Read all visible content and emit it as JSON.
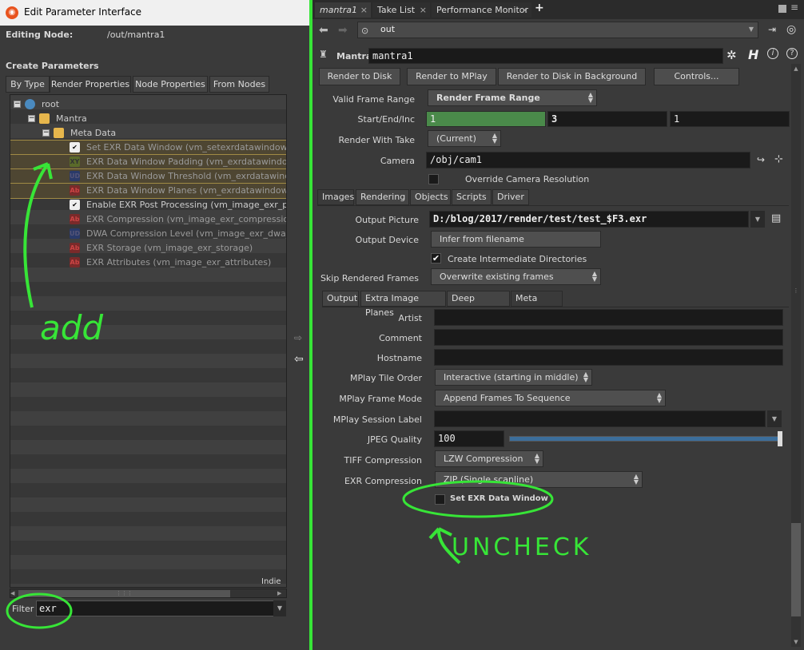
{
  "left_panel": {
    "title": "Edit Parameter Interface",
    "editing_node_label": "Editing Node:",
    "editing_node_value": "/out/mantra1",
    "create_params_label": "Create Parameters",
    "tabs": [
      "By Type",
      "Render Properties",
      "Node Properties",
      "From Nodes"
    ],
    "tree": [
      {
        "label": "root",
        "indent": 0
      },
      {
        "label": "Mantra",
        "indent": 1
      },
      {
        "label": "Meta Data",
        "indent": 2
      },
      {
        "label": "Set EXR Data Window (vm_setexrdatawindow)",
        "indent": 3,
        "icon": "check",
        "hl": true
      },
      {
        "label": "EXR Data Window Padding (vm_exrdatawindowpa",
        "indent": 3,
        "icon": "xy",
        "hl": true
      },
      {
        "label": "EXR Data Window Threshold (vm_exrdatawindowt",
        "indent": 3,
        "icon": "ud",
        "hl": true
      },
      {
        "label": "EXR Data Window Planes (vm_exrdatawindowplan",
        "indent": 3,
        "icon": "ab",
        "hl": true
      },
      {
        "label": "Enable EXR Post Processing (vm_image_exr_postp",
        "indent": 3,
        "icon": "check"
      },
      {
        "label": "EXR Compression (vm_image_exr_compression)",
        "indent": 3,
        "icon": "ab"
      },
      {
        "label": "DWA Compression Level (vm_image_exr_dwa_lev",
        "indent": 3,
        "icon": "ud"
      },
      {
        "label": "EXR Storage (vm_image_exr_storage)",
        "indent": 3,
        "icon": "ab"
      },
      {
        "label": "EXR Attributes (vm_image_exr_attributes)",
        "indent": 3,
        "icon": "ab"
      }
    ],
    "indie_label": "Indie",
    "filter_label": "Filter",
    "filter_value": "exr"
  },
  "right_panel": {
    "tabs": [
      "mantra1",
      "Take List",
      "Performance Monitor"
    ],
    "path": "out",
    "node_type": "Mantra",
    "node_name": "mantra1",
    "buttons": [
      "Render to Disk",
      "Render to MPlay",
      "Render to Disk in Background",
      "Controls..."
    ],
    "valid_frame_range_label": "Valid Frame Range",
    "valid_frame_range_value": "Render Frame Range",
    "start_end_inc_label": "Start/End/Inc",
    "start": "1",
    "end": "3",
    "inc": "1",
    "render_with_take_label": "Render With Take",
    "render_with_take_value": "(Current)",
    "camera_label": "Camera",
    "camera_value": "/obj/cam1",
    "override_cam_label": "Override Camera Resolution",
    "main_tabs": [
      "Images",
      "Rendering",
      "Objects",
      "Scripts",
      "Driver"
    ],
    "output_picture_label": "Output Picture",
    "output_picture_value": "D:/blog/2017/render/test/test_$F3.exr",
    "output_device_label": "Output Device",
    "output_device_value": "Infer from filename",
    "create_dirs_label": "Create Intermediate Directories",
    "skip_frames_label": "Skip Rendered Frames",
    "skip_frames_value": "Overwrite existing frames",
    "sub_tabs": [
      "Output",
      "Extra Image Planes",
      "Deep Output",
      "Meta Data"
    ],
    "artist_label": "Artist",
    "comment_label": "Comment",
    "hostname_label": "Hostname",
    "mplay_tile_label": "MPlay Tile Order",
    "mplay_tile_value": "Interactive (starting in middle)",
    "mplay_frame_label": "MPlay Frame Mode",
    "mplay_frame_value": "Append Frames To Sequence",
    "mplay_session_label": "MPlay Session Label",
    "jpeg_quality_label": "JPEG Quality",
    "jpeg_quality_value": "100",
    "jpeg_quality_fraction": 1.0,
    "tiff_label": "TIFF Compression",
    "tiff_value": "LZW Compression",
    "exr_label": "EXR Compression",
    "exr_value": "ZIP (Single scanline)",
    "set_exr_window_label": "Set EXR Data Window"
  },
  "annotations": {
    "add": "add",
    "uncheck": "UNCHECK"
  }
}
